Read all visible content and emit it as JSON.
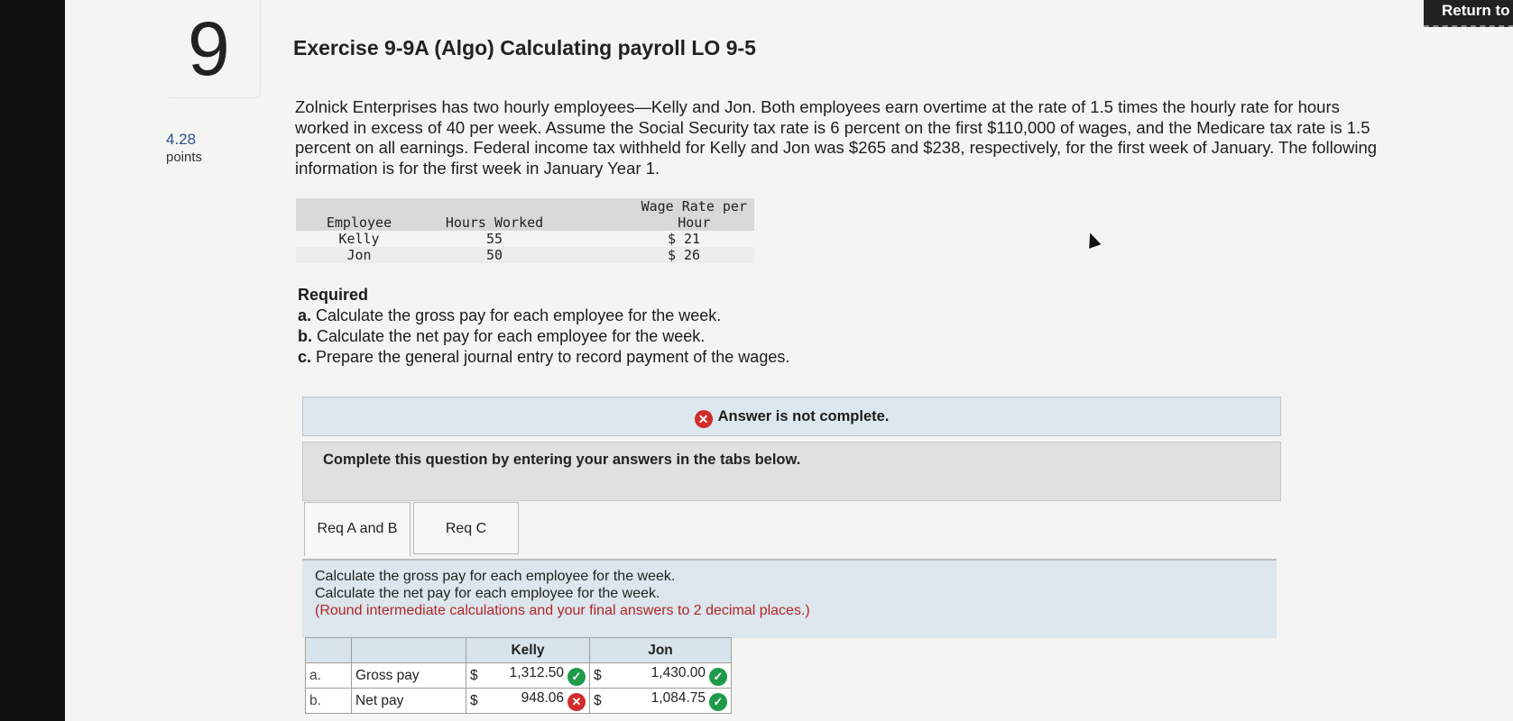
{
  "question": {
    "number": "9",
    "points_value": "4.28",
    "points_label": "points"
  },
  "return_button": "Return to",
  "title": "Exercise 9-9A (Algo) Calculating payroll LO 9-5",
  "intro": "Zolnick Enterprises has two hourly employees—Kelly and Jon. Both employees earn overtime at the rate of 1.5 times the hourly rate for hours worked in excess of 40 per week. Assume the Social Security tax rate is 6 percent on the first $110,000 of wages, and the Medicare tax rate is 1.5 percent on all earnings. Federal income tax withheld for Kelly and Jon was $265 and $238, respectively, for the first week of January. The following information is for the first week in January Year 1.",
  "data_table": {
    "headers": {
      "employee": "Employee",
      "hours": "Hours Worked",
      "rate_line1": "Wage Rate per",
      "rate_line2": "Hour"
    },
    "rows": [
      {
        "employee": "Kelly",
        "hours": "55",
        "rate": "$ 21"
      },
      {
        "employee": "Jon",
        "hours": "50",
        "rate": "$ 26"
      }
    ]
  },
  "required": {
    "heading": "Required",
    "items": [
      {
        "letter": "a.",
        "text": "Calculate the gross pay for each employee for the week."
      },
      {
        "letter": "b.",
        "text": "Calculate the net pay for each employee for the week."
      },
      {
        "letter": "c.",
        "text": "Prepare the general journal entry to record payment of the wages."
      }
    ]
  },
  "banner": "Answer is not complete.",
  "instructions": "Complete this question by entering your answers in the tabs below.",
  "tabs": [
    {
      "label": "Req A and B"
    },
    {
      "label": "Req C"
    }
  ],
  "panel": {
    "line1": "Calculate the gross pay for each employee for the week.",
    "line2": "Calculate the net pay for each employee for the week.",
    "note": "(Round intermediate calculations and your final answers to 2 decimal places.)"
  },
  "answer_table": {
    "col_kelly": "Kelly",
    "col_jon": "Jon",
    "rows": [
      {
        "idx": "a.",
        "label": "Gross pay",
        "kelly_sym": "$",
        "kelly": "1,312.50",
        "kelly_status": "correct",
        "jon_sym": "$",
        "jon": "1,430.00",
        "jon_status": "correct"
      },
      {
        "idx": "b.",
        "label": "Net pay",
        "kelly_sym": "$",
        "kelly": "948.06",
        "kelly_status": "incorrect",
        "jon_sym": "$",
        "jon": "1,084.75",
        "jon_status": "correct"
      }
    ]
  },
  "colors": {
    "correct": "#1e9a4a",
    "incorrect": "#d22b2b",
    "note": "#b0262b",
    "points": "#2d4f8a"
  }
}
